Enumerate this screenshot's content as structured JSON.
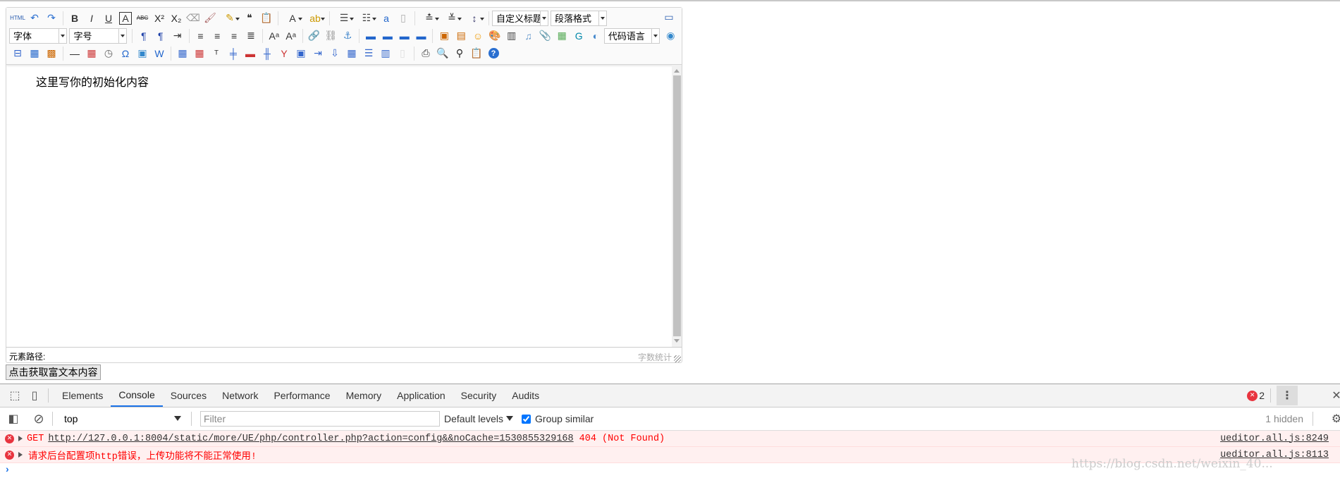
{
  "editor": {
    "toolbar": {
      "row1": [
        "html",
        "undo",
        "redo",
        "|",
        "bold",
        "italic",
        "underline",
        "fontborder",
        "strikethrough",
        "superscript",
        "subscript",
        "removeformat",
        "formatmatch",
        "autotypeset*",
        "blockquote",
        "pasteplain",
        "|",
        "forecolor*",
        "backcolor*",
        "|",
        "insertorderedlist*",
        "insertunorderedlist*",
        "selectall",
        "cleardoc",
        "|",
        "rowspacingtop*",
        "rowspacingbottom*",
        "lineheight*",
        "|"
      ],
      "row2": [
        "ltr",
        "rtl",
        "indent",
        "|",
        "justifyleft",
        "justifycenter",
        "justifyright",
        "justifyjustify",
        "|",
        "touppercase",
        "tolowercase",
        "|",
        "link",
        "unlink",
        "anchor",
        "|",
        "imagenone",
        "imageleft",
        "imageright",
        "imagecenter",
        "|",
        "simpleupload",
        "insertimage",
        "emotion",
        "scrawl",
        "insertvideo",
        "music",
        "attachment",
        "map",
        "gmap",
        "webapp"
      ],
      "row3": [
        "insertframe",
        "template",
        "background",
        "|",
        "horizontal",
        "date",
        "time",
        "spechars",
        "snapscreen",
        "wordimage",
        "|",
        "inserttable",
        "deletetable",
        "insertparagraphbeforetable",
        "insertrow",
        "deleterow",
        "insertcol",
        "deletecol",
        "mergecells",
        "mergeright",
        "mergedown",
        "splittocells",
        "splittorows",
        "splittocols",
        "charts",
        "|",
        "print",
        "preview",
        "searchreplace",
        "drafts",
        "help"
      ],
      "customstyle": "自定义标题",
      "paragraph": "段落格式",
      "fontfamily": "字体",
      "fontsize": "字号",
      "codelanguage": "代码语言"
    },
    "content": "这里写你的初始化内容",
    "element_path_label": "元素路径:",
    "word_count_label": "字数统计"
  },
  "get_content_button": "点击获取富文本内容",
  "devtools": {
    "tabs": [
      "Elements",
      "Console",
      "Sources",
      "Network",
      "Performance",
      "Memory",
      "Application",
      "Security",
      "Audits"
    ],
    "active_tab": "Console",
    "error_count": "2",
    "context": "top",
    "filter_placeholder": "Filter",
    "levels": "Default levels",
    "group_similar": "Group similar",
    "group_similar_checked": true,
    "hidden": "1 hidden",
    "messages": [
      {
        "method": "GET",
        "url": "http://127.0.0.1:8004/static/more/UE/php/controller.php?action=config&&noCache=1530855329168",
        "status": "404 (Not Found)",
        "source": "ueditor.all.js:8249"
      },
      {
        "text": "请求后台配置项http错误，上传功能将不能正常使用!",
        "source": "ueditor.all.js:8113"
      }
    ],
    "error_color": "#ff0000",
    "accent": "#1a73e8"
  },
  "watermark": "https://blog.csdn.net/weixin_40..."
}
